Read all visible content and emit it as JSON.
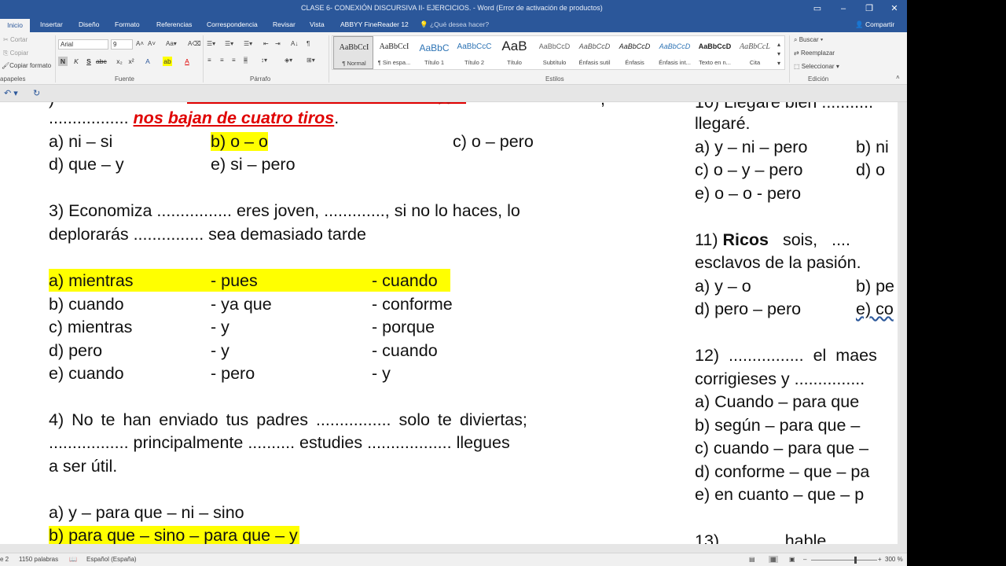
{
  "window": {
    "title": "CLASE 6- CONEXIÓN DISCURSIVA II- EJERCICIOS. - Word (Error de activación de productos)"
  },
  "tabs": {
    "active": "Inicio",
    "items": [
      "Insertar",
      "Diseño",
      "Formato",
      "Referencias",
      "Correspondencia",
      "Revisar",
      "Vista",
      "ABBYY FineReader 12"
    ],
    "tell_me": "¿Qué desea hacer?",
    "share": "Compartir"
  },
  "ribbon": {
    "clipboard": {
      "cut": "Cortar",
      "copy": "Copiar",
      "format_painter": "Copiar formato",
      "label": "apapeles"
    },
    "font": {
      "name": "Arial",
      "size": "9",
      "label": "Fuente"
    },
    "paragraph": {
      "label": "Párrafo"
    },
    "styles": {
      "label": "Estilos",
      "items": [
        {
          "sample": "AaBbCcI",
          "name": "¶ Normal"
        },
        {
          "sample": "AaBbCcI",
          "name": "¶ Sin espa..."
        },
        {
          "sample": "AaBbC",
          "name": "Título 1"
        },
        {
          "sample": "AaBbCcC",
          "name": "Título 2"
        },
        {
          "sample": "AaB",
          "name": "Título"
        },
        {
          "sample": "AaBbCcD",
          "name": "Subtítulo"
        },
        {
          "sample": "AaBbCcD",
          "name": "Énfasis sutil"
        },
        {
          "sample": "AaBbCcD",
          "name": "Énfasis"
        },
        {
          "sample": "AaBbCcD",
          "name": "Énfasis int..."
        },
        {
          "sample": "AaBbCcD",
          "name": "Texto en n..."
        },
        {
          "sample": "AaBbCcL",
          "name": "Cita"
        }
      ]
    },
    "editing": {
      "find": "Buscar",
      "replace": "Reemplazar",
      "select": "Seleccionar",
      "label": "Edición"
    }
  },
  "document": {
    "left": {
      "line_top_fragment": "nos bajan de cuatro tiros",
      "dots_prefix": ".................",
      "q2_options": {
        "a": "a) ni – si",
        "b": "b) o – o",
        "c": "c) o – pero",
        "d": "d) que – y",
        "e": "e) si – pero"
      },
      "q3_line1": "3) Economiza ................ eres joven, ............., si no lo haces, lo",
      "q3_line2": "deplorarás ............... sea demasiado tarde",
      "q3_rows": [
        [
          "a) mientras",
          "- pues",
          "- cuando"
        ],
        [
          "b) cuando",
          "- ya que",
          "- conforme"
        ],
        [
          "c) mientras",
          "- y",
          "- porque"
        ],
        [
          "d) pero",
          "- y",
          "- cuando"
        ],
        [
          "e) cuando",
          "- pero",
          "- y"
        ]
      ],
      "q4_line1": "4) No te han enviado tus padres ................ solo te diviertas;",
      "q4_line2": "................. principalmente .......... estudies .................. llegues",
      "q4_line3": "a ser útil.",
      "q4_a": "a) y – para que – ni – sino",
      "q4_b": "b) para que – sino – para que – y"
    },
    "right": {
      "top_partial": "10) Llegaré bien ...........",
      "line_llegare": "llegaré.",
      "q10": [
        "a) y – ni – pero",
        "b) ni",
        "c) o – y – pero",
        "d) o",
        "e) o – o - pero"
      ],
      "q11_num": "11)",
      "q11_bold": "Ricos",
      "q11_rest": "sois,",
      "q11_dots": "....",
      "q11_line2": "esclavos de la pasión.",
      "q11": [
        "a) y – o",
        "b) pe",
        "d) pero – pero",
        "e) co"
      ],
      "q12_line1": "12) ................ el maes",
      "q12_line2": "corrigieses y ...............",
      "q12": [
        "a) Cuando – para que",
        "b) según – para que –",
        "c) cuando – para que –",
        "d) conforme – que – pa",
        "e) en cuanto – que – p"
      ],
      "q13_partial": "13)              hable"
    }
  },
  "status": {
    "page": "e 2",
    "words": "1150 palabras",
    "language": "Español (España)",
    "zoom": "300 %"
  }
}
